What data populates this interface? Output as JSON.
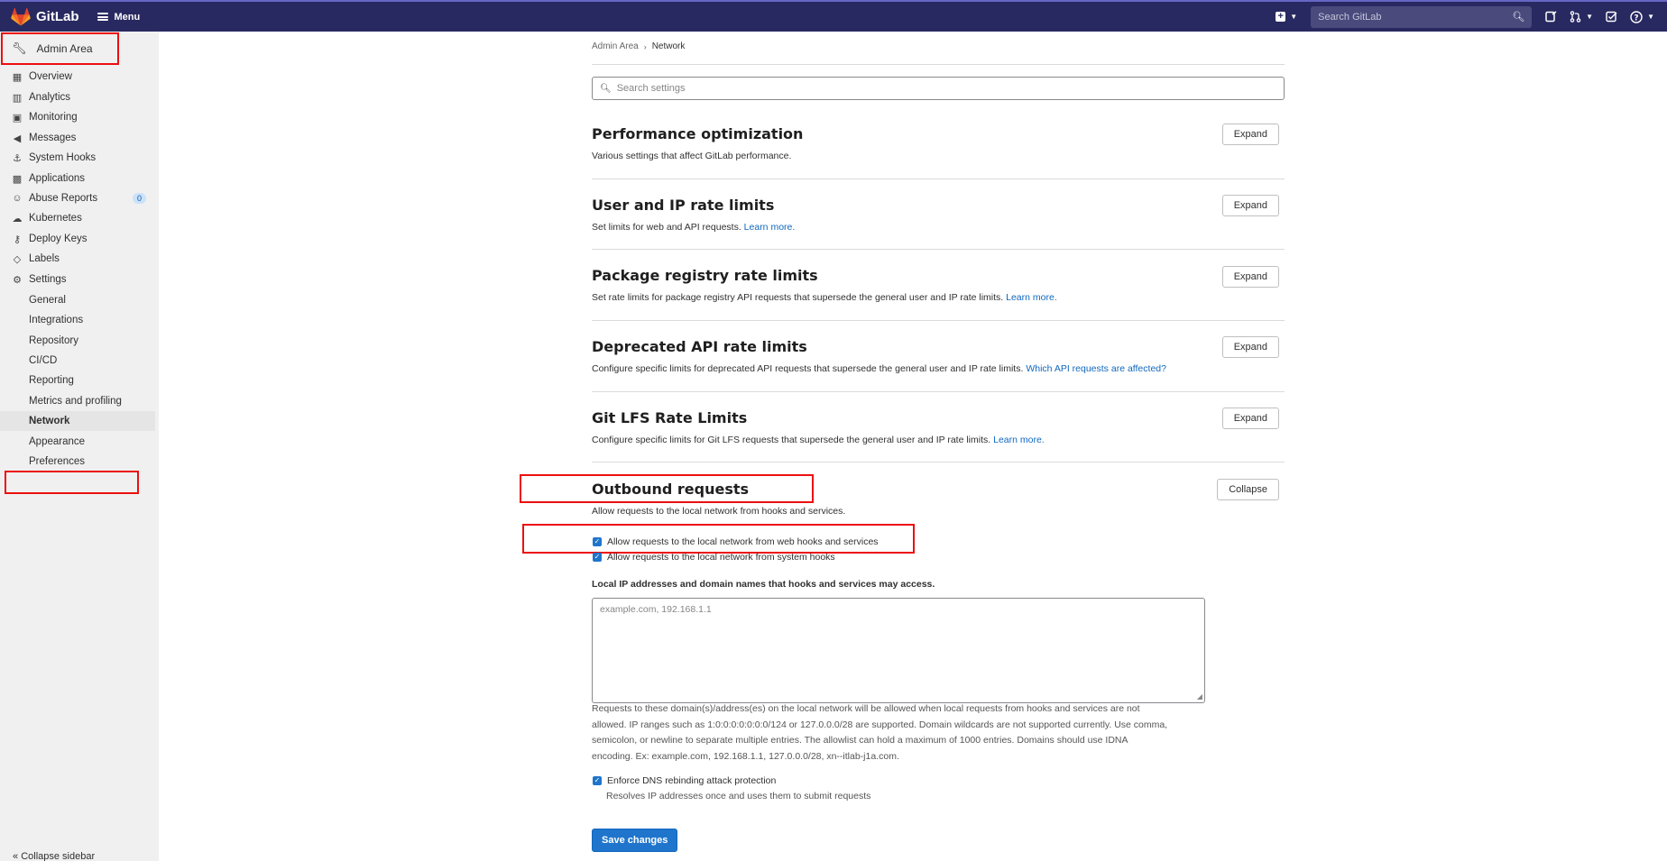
{
  "topbar": {
    "brand": "GitLab",
    "menu_label": "Menu",
    "search_placeholder": "Search GitLab",
    "icons": [
      "plus-icon",
      "issues-icon",
      "merge-request-icon",
      "todo-icon",
      "help-icon"
    ]
  },
  "sidebar": {
    "header": "Admin Area",
    "items": [
      {
        "label": "Overview",
        "icon": "overview-icon"
      },
      {
        "label": "Analytics",
        "icon": "analytics-icon"
      },
      {
        "label": "Monitoring",
        "icon": "monitoring-icon"
      },
      {
        "label": "Messages",
        "icon": "messages-icon"
      },
      {
        "label": "System Hooks",
        "icon": "hooks-icon"
      },
      {
        "label": "Applications",
        "icon": "applications-icon"
      },
      {
        "label": "Abuse Reports",
        "icon": "abuse-icon",
        "badge": "0"
      },
      {
        "label": "Kubernetes",
        "icon": "kubernetes-icon"
      },
      {
        "label": "Deploy Keys",
        "icon": "key-icon"
      },
      {
        "label": "Labels",
        "icon": "label-icon"
      },
      {
        "label": "Settings",
        "icon": "settings-icon"
      }
    ],
    "settings_sub": [
      "General",
      "Integrations",
      "Repository",
      "CI/CD",
      "Reporting",
      "Metrics and profiling",
      "Network",
      "Appearance",
      "Preferences"
    ],
    "active_sub": "Network",
    "collapse_label": "Collapse sidebar"
  },
  "breadcrumb": {
    "parent": "Admin Area",
    "current": "Network"
  },
  "search_settings_placeholder": "Search settings",
  "sections": [
    {
      "title": "Performance optimization",
      "desc": "Various settings that affect GitLab performance.",
      "link": "",
      "button": "Expand"
    },
    {
      "title": "User and IP rate limits",
      "desc": "Set limits for web and API requests. ",
      "link": "Learn more.",
      "button": "Expand"
    },
    {
      "title": "Package registry rate limits",
      "desc": "Set rate limits for package registry API requests that supersede the general user and IP rate limits. ",
      "link": "Learn more.",
      "button": "Expand"
    },
    {
      "title": "Deprecated API rate limits",
      "desc": "Configure specific limits for deprecated API requests that supersede the general user and IP rate limits. ",
      "link": "Which API requests are affected?",
      "button": "Expand"
    },
    {
      "title": "Git LFS Rate Limits",
      "desc": "Configure specific limits for Git LFS requests that supersede the general user and IP rate limits. ",
      "link": "Learn more.",
      "button": "Expand"
    }
  ],
  "outbound": {
    "title": "Outbound requests",
    "desc": "Allow requests to the local network from hooks and services.",
    "button": "Collapse",
    "cb_web_hooks": "Allow requests to the local network from web hooks and services",
    "cb_system_hooks": "Allow requests to the local network from system hooks",
    "allowlist_label": "Local IP addresses and domain names that hooks and services may access.",
    "allowlist_placeholder": "example.com, 192.168.1.1",
    "help_lines": [
      "Requests to these domain(s)/address(es) on the local network will be allowed when local requests from hooks and services are not",
      "allowed. IP ranges such as 1:0:0:0:0:0:0:0/124 or 127.0.0.0/28 are supported. Domain wildcards are not supported currently. Use comma,",
      "semicolon, or newline to separate multiple entries. The allowlist can hold a maximum of 1000 entries. Domains should use IDNA",
      "encoding. Ex: example.com, 192.168.1.1, 127.0.0.0/28, xn--itlab-j1a.com."
    ],
    "cb_dns": "Enforce DNS rebinding attack protection",
    "cb_dns_help": "Resolves IP addresses once and uses them to submit requests",
    "save": "Save changes"
  }
}
